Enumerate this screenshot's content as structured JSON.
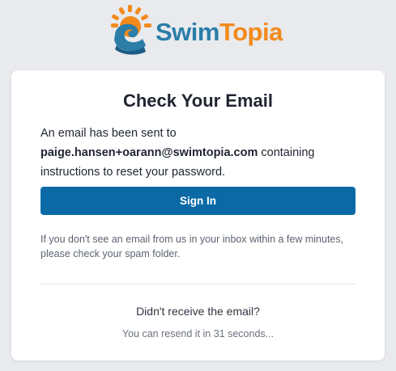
{
  "brand": {
    "name_part1": "Swim",
    "name_part2": "Topia",
    "colors": {
      "blue": "#2a7ea8",
      "orange": "#f28a1c",
      "dark_blue": "#1c5d86"
    },
    "logo_icon": "sun-wave-icon"
  },
  "card": {
    "title": "Check Your Email",
    "message_prefix": "An email has been sent to",
    "email": "paige.hansen+oarann@swimtopia.com",
    "message_suffix": " containing instructions to reset your password.",
    "signin_label": "Sign In",
    "signin_color": "#0b6aa6",
    "spam_note": "If you don't see an email from us in your inbox within a few minutes, please check your spam folder.",
    "didnt_receive": "Didn't receive the email?",
    "resend_text": "You can resend it in 31 seconds..."
  }
}
